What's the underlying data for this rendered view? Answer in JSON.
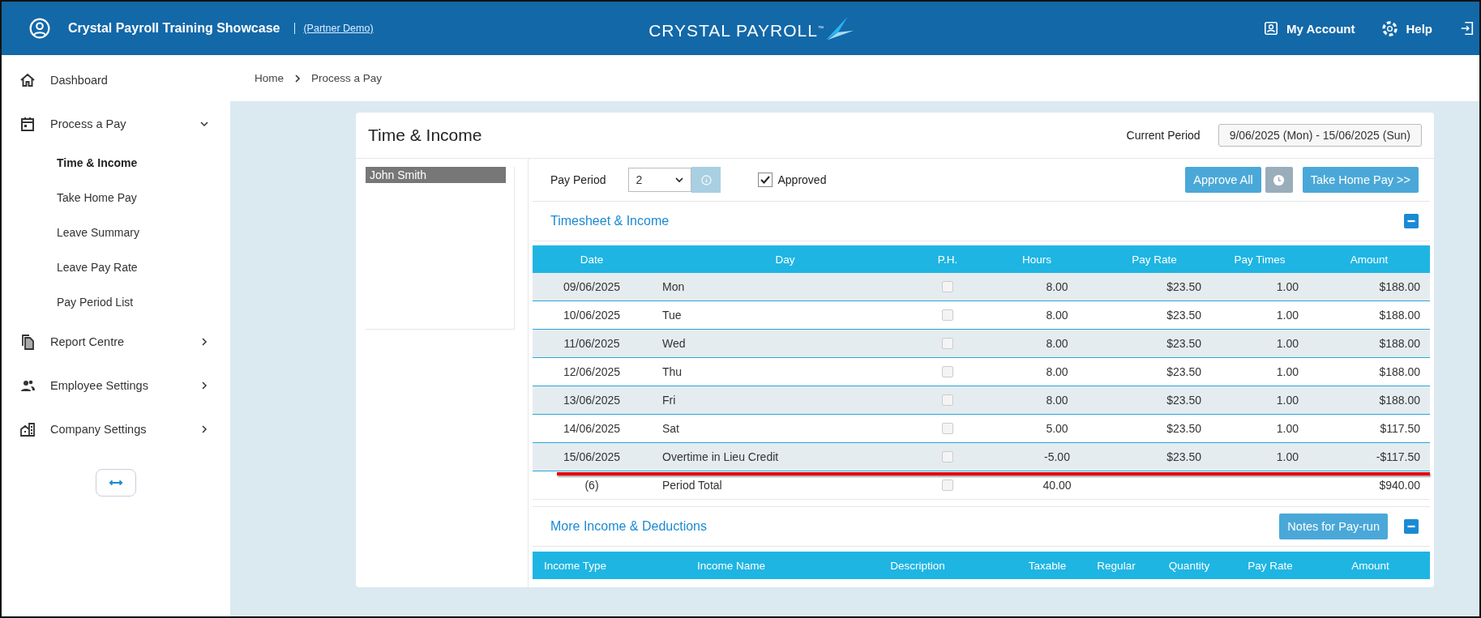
{
  "header": {
    "app_title": "Crystal Payroll Training Showcase",
    "subtitle": "(Partner Demo)",
    "logo": "CRYSTAL PAYROLL",
    "logo_mark": "™",
    "actions": [
      {
        "kind": "account",
        "label": "My Account"
      },
      {
        "kind": "help",
        "label": "Help"
      },
      {
        "kind": "logout"
      }
    ]
  },
  "sidebar": {
    "items": [
      {
        "kind": "link",
        "label": "Dashboard"
      },
      {
        "kind": "group",
        "label": "Process a Pay",
        "expanded": true,
        "children": [
          {
            "label": "Time & Income",
            "selected": true
          },
          {
            "label": "Take Home Pay",
            "selected": false
          },
          {
            "label": "Leave Summary",
            "selected": false
          },
          {
            "label": "Leave Pay Rate",
            "selected": false
          },
          {
            "label": "Pay Period List",
            "selected": false
          }
        ]
      },
      {
        "kind": "group",
        "label": "Report Centre",
        "expanded": false
      },
      {
        "kind": "group",
        "label": "Employee Settings",
        "expanded": false
      },
      {
        "kind": "group",
        "label": "Company Settings",
        "expanded": false
      }
    ]
  },
  "breadcrumb": [
    "Home",
    "Process a Pay"
  ],
  "card": {
    "title": "Time & Income",
    "current_period_label": "Current Period",
    "current_period": "9/06/2025 (Mon) - 15/06/2025 (Sun)",
    "employees": [
      {
        "name": "John Smith",
        "selected": true
      }
    ],
    "pay_period_label": "Pay Period",
    "pay_period": "2",
    "approved": {
      "label": "Approved",
      "checked": true
    },
    "buttons": [
      {
        "kind": "text",
        "label": "Approve All"
      },
      {
        "kind": "clock"
      },
      {
        "kind": "text",
        "label": "Take Home Pay >>"
      }
    ],
    "timesheet": {
      "title": "Timesheet & Income",
      "expanded": true,
      "columns": [
        "Date",
        "Day",
        "P.H.",
        "Hours",
        "Pay Rate",
        "Pay Times",
        "Amount"
      ],
      "rows": [
        {
          "date": "09/06/2025",
          "day": "Mon",
          "ph": false,
          "hours": "8.00",
          "pay_rate": "$23.50",
          "pay_times": "1.00",
          "amount": "$188.00",
          "underlined": false
        },
        {
          "date": "10/06/2025",
          "day": "Tue",
          "ph": false,
          "hours": "8.00",
          "pay_rate": "$23.50",
          "pay_times": "1.00",
          "amount": "$188.00",
          "underlined": false
        },
        {
          "date": "11/06/2025",
          "day": "Wed",
          "ph": false,
          "hours": "8.00",
          "pay_rate": "$23.50",
          "pay_times": "1.00",
          "amount": "$188.00",
          "underlined": false
        },
        {
          "date": "12/06/2025",
          "day": "Thu",
          "ph": false,
          "hours": "8.00",
          "pay_rate": "$23.50",
          "pay_times": "1.00",
          "amount": "$188.00",
          "underlined": false
        },
        {
          "date": "13/06/2025",
          "day": "Fri",
          "ph": false,
          "hours": "8.00",
          "pay_rate": "$23.50",
          "pay_times": "1.00",
          "amount": "$188.00",
          "underlined": false
        },
        {
          "date": "14/06/2025",
          "day": "Sat",
          "ph": false,
          "hours": "5.00",
          "pay_rate": "$23.50",
          "pay_times": "1.00",
          "amount": "$117.50",
          "underlined": false
        },
        {
          "date": "15/06/2025",
          "day": "Overtime in Lieu Credit",
          "ph": false,
          "hours": "-5.00",
          "pay_rate": "$23.50",
          "pay_times": "1.00",
          "amount": "-$117.50",
          "underlined": true
        }
      ],
      "total": {
        "count": "(6)",
        "label": "Period Total",
        "ph": false,
        "hours": "40.00",
        "amount": "$940.00"
      }
    },
    "income": {
      "title": "More Income & Deductions",
      "notes_button": "Notes for Pay-run",
      "expanded": true,
      "columns": [
        "Income Type",
        "Income Name",
        "Description",
        "Taxable",
        "Regular",
        "Quantity",
        "Pay Rate",
        "Amount"
      ]
    }
  }
}
